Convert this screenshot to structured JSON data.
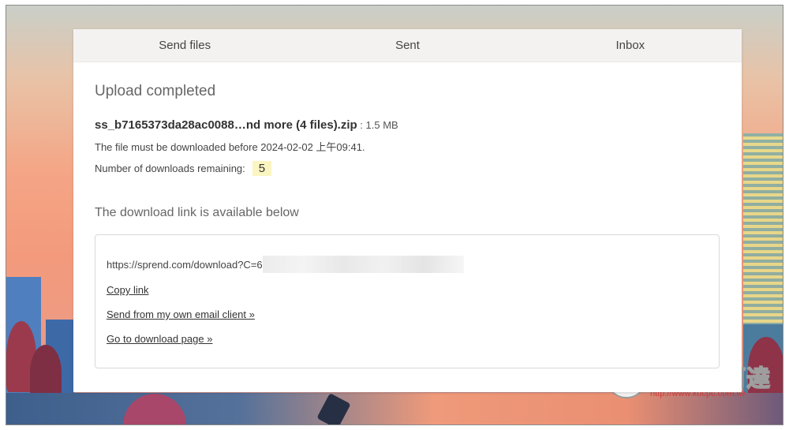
{
  "tabs": [
    {
      "label": "Send files"
    },
    {
      "label": "Sent"
    },
    {
      "label": "Inbox"
    }
  ],
  "main": {
    "heading": "Upload completed",
    "file_name": "ss_b7165373da28ac0088…nd more (4 files).zip",
    "file_size": " : 1.5 MB",
    "expiry_text": "The file must be downloaded before 2024-02-02  上午09:41.",
    "remaining_label": "Number of downloads remaining:",
    "remaining_count": "5",
    "link_heading": "The download link is available below",
    "download_url": "https://sprend.com/download?C=6",
    "copy_link": "Copy link",
    "send_email": "Send from my own email client »",
    "go_to_page": "Go to download page »"
  },
  "watermark": {
    "title": "電腦王阿達",
    "url": "http://www.kocpc.com.tw"
  },
  "colors": {
    "tab_bar": "#f4f2f1",
    "badge": "#fbf5c2"
  }
}
